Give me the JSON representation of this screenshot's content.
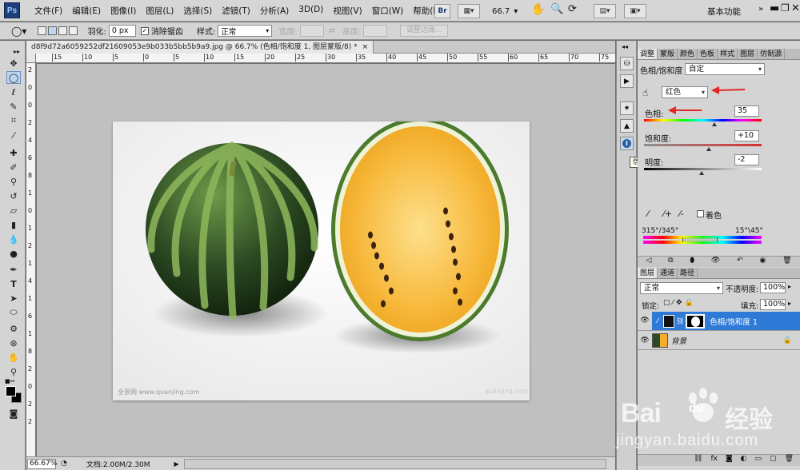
{
  "app": {
    "logo": "Ps"
  },
  "menu": [
    "文件(F)",
    "编辑(E)",
    "图像(I)",
    "图层(L)",
    "选择(S)",
    "滤镜(T)",
    "分析(A)",
    "3D(D)",
    "视图(V)",
    "窗口(W)",
    "帮助(H)"
  ],
  "menubar": {
    "br_label": "Br",
    "zoom": "66.7",
    "workspace": "基本功能"
  },
  "options": {
    "feather_label": "羽化:",
    "feather_value": "0 px",
    "antialias_label": "消除锯齿",
    "style_label": "样式:",
    "style_value": "正常",
    "width_label": "宽度:",
    "height_label": "高度:",
    "refine_label": "调整边缘..."
  },
  "document": {
    "tab": "d8f9d72a6059252df21609053e9b033b5bb5b9a9.jpg @ 66.7% (色相/饱和度 1, 图层蒙版/8) *",
    "close": "×",
    "ruler_top": [
      "15",
      "10",
      "5",
      "0",
      "5",
      "10",
      "15",
      "20",
      "25",
      "30",
      "35",
      "40",
      "45",
      "50",
      "55",
      "60",
      "65",
      "70",
      "75"
    ],
    "ruler_left": [
      "2",
      "0",
      "0",
      "2",
      "4",
      "6",
      "8",
      "1",
      "0",
      "1",
      "2",
      "1",
      "4",
      "1",
      "6",
      "1",
      "8",
      "2",
      "0",
      "2",
      "2"
    ],
    "image_caption_left": "全景网 www.quanjing.com",
    "image_caption_right": "quanjing.com"
  },
  "status": {
    "zoom": "66.67%",
    "doc": "文档:2.00M/2.30M"
  },
  "tooltip": "信息",
  "adjust": {
    "tabs": [
      "调整",
      "蒙版",
      "颜色",
      "色板",
      "样式",
      "图层",
      "仿制源"
    ],
    "title": "色相/饱和度",
    "preset": "自定",
    "channel": "红色",
    "hue_label": "色相:",
    "hue_value": "35",
    "hue_level": 0.6,
    "sat_label": "饱和度:",
    "sat_value": "+10",
    "sat_level": 0.55,
    "light_label": "明度:",
    "light_value": "-2",
    "light_level": 0.49,
    "colorize_label": "着色",
    "range_left": "315°/345°",
    "range_right": "15°\\45°"
  },
  "layers": {
    "tabs": [
      "图层",
      "通道",
      "路径"
    ],
    "blend": "正常",
    "opacity_label": "不透明度:",
    "opacity": "100%",
    "lock_label": "锁定:",
    "fill_label": "填充:",
    "fill": "100%",
    "rows": [
      {
        "name": "色相/饱和度 1"
      },
      {
        "name": "背景"
      }
    ]
  },
  "watermark": {
    "logo_text": "Bai",
    "logo_paw": "du",
    "logo_cn": "经验",
    "url": "jingyan.baidu.com"
  },
  "colors": {
    "accent": "#0078d7",
    "selected_layer": "#2f7ad6"
  }
}
